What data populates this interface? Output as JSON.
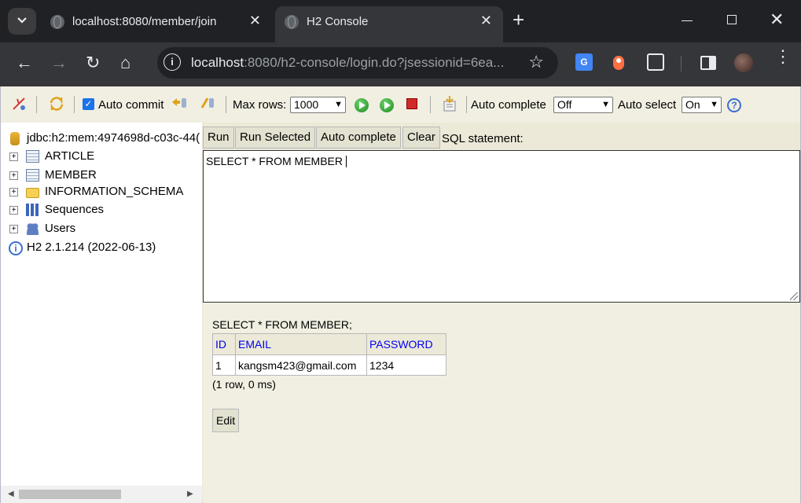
{
  "browser": {
    "tabs": [
      {
        "title": "localhost:8080/member/join",
        "active": false
      },
      {
        "title": "H2 Console",
        "active": true
      }
    ],
    "url": {
      "host": "localhost",
      "rest": ":8080/h2-console/login.do?jsessionid=6ea..."
    },
    "extensions": [
      "translate-icon",
      "extension-dot-icon",
      "puzzle-icon",
      "side-panel-icon",
      "avatar"
    ]
  },
  "h2": {
    "toolbar": {
      "auto_commit_label": "Auto commit",
      "auto_commit_checked": true,
      "max_rows_label": "Max rows:",
      "max_rows_value": "1000",
      "auto_complete_label": "Auto complete",
      "auto_complete_value": "Off",
      "auto_select_label": "Auto select",
      "auto_select_value": "On",
      "help_symbol": "?"
    },
    "tree": {
      "connection": "jdbc:h2:mem:4974698d-c03c-44(",
      "items": [
        {
          "label": "ARTICLE",
          "icon": "table-icon"
        },
        {
          "label": "MEMBER",
          "icon": "table-icon"
        },
        {
          "label": "INFORMATION_SCHEMA",
          "icon": "folder-icon"
        },
        {
          "label": "Sequences",
          "icon": "sequences-icon"
        },
        {
          "label": "Users",
          "icon": "users-icon"
        }
      ],
      "version": "H2 2.1.214 (2022-06-13)"
    },
    "buttons": {
      "run": "Run",
      "run_selected": "Run Selected",
      "auto_complete": "Auto complete",
      "clear": "Clear",
      "sql_statement_label": "SQL statement:"
    },
    "sql_text": "SELECT * FROM MEMBER",
    "result": {
      "query": "SELECT * FROM MEMBER;",
      "columns": [
        "ID",
        "EMAIL",
        "PASSWORD"
      ],
      "rows": [
        [
          "1",
          "kangsm423@gmail.com",
          "1234"
        ]
      ],
      "summary": "(1 row, 0 ms)",
      "edit_label": "Edit"
    }
  }
}
